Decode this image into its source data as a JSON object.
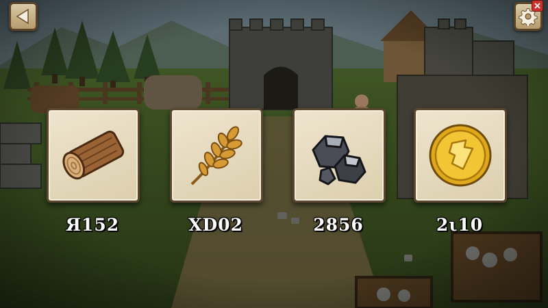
{
  "resources": [
    {
      "name": "wood-icon",
      "value": "Я152"
    },
    {
      "name": "wheat-icon",
      "value": "XD02"
    },
    {
      "name": "stone-icon",
      "value": "2856"
    },
    {
      "name": "gold-coin-icon",
      "value": "2ι10"
    }
  ],
  "controls": {
    "back": "back-arrow-icon",
    "settings": "gear-icon",
    "close": "close-icon"
  },
  "colors": {
    "card_bg": "#e8dcc0",
    "card_border": "#5b4630",
    "button_bg": "#c8b387",
    "close_red": "#c8322a",
    "value_text": "#ffffff"
  }
}
